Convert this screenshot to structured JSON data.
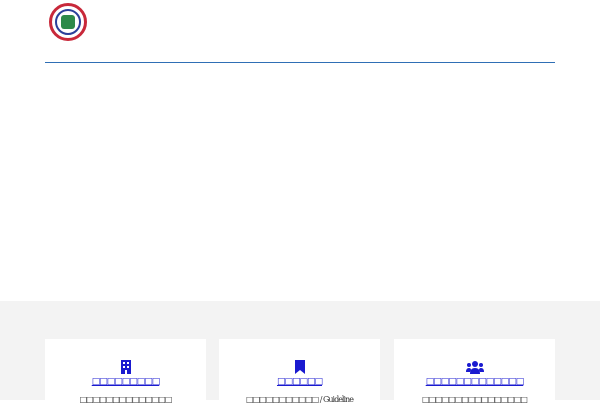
{
  "header": {
    "logo": "organization-seal"
  },
  "cards": [
    {
      "icon": "building-icon",
      "title": "□□□□□□□□□",
      "subtitle": "□□□□□□□□□□□□□□"
    },
    {
      "icon": "bookmark-icon",
      "title": "□□□□□□",
      "subtitle": "□□□□□□□□□□□ / Guideline"
    },
    {
      "icon": "users-icon",
      "title": "□□□□□□□□□□□□□",
      "subtitle": "□□□□□□□□□□□□□□□□"
    }
  ],
  "colors": {
    "accent": "#1a1ad0",
    "rule": "#2f6fb5",
    "band": "#f3f3f3"
  }
}
